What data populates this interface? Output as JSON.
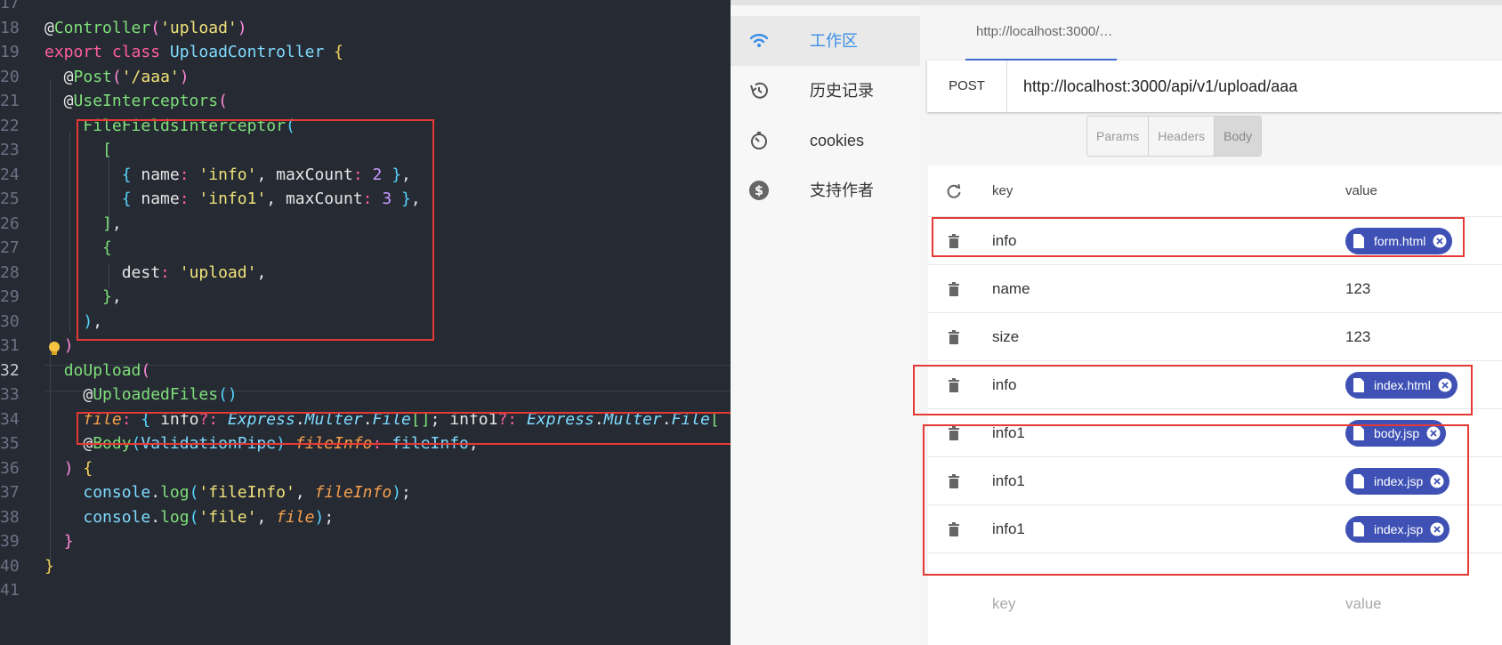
{
  "editor": {
    "lines": [
      {
        "num": "17",
        "active": false,
        "tokens": []
      },
      {
        "num": "18",
        "active": false,
        "tokens": [
          [
            "@",
            "t-at"
          ],
          [
            "Controller",
            "t-dec"
          ],
          [
            "(",
            "t-par"
          ],
          [
            "'upload'",
            "t-str"
          ],
          [
            ")",
            "t-par"
          ]
        ]
      },
      {
        "num": "19",
        "active": false,
        "tokens": [
          [
            "export ",
            "t-kw"
          ],
          [
            "class ",
            "t-kw"
          ],
          [
            "UploadController ",
            "t-cls"
          ],
          [
            "{",
            "t-yel"
          ]
        ]
      },
      {
        "num": "20",
        "active": false,
        "tokens": [
          [
            "  @",
            "t-at"
          ],
          [
            "Post",
            "t-dec"
          ],
          [
            "(",
            "t-par"
          ],
          [
            "'/aaa'",
            "t-str"
          ],
          [
            ")",
            "t-par"
          ]
        ]
      },
      {
        "num": "21",
        "active": false,
        "tokens": [
          [
            "  @",
            "t-at"
          ],
          [
            "UseInterceptors",
            "t-dec"
          ],
          [
            "(",
            "t-par"
          ]
        ]
      },
      {
        "num": "22",
        "active": false,
        "tokens": [
          [
            "    ",
            "t-at"
          ],
          [
            "FileFieldsInterceptor",
            "t-fn"
          ],
          [
            "(",
            "t-br"
          ]
        ]
      },
      {
        "num": "23",
        "active": false,
        "tokens": [
          [
            "      ",
            "t-at"
          ],
          [
            "[",
            "t-dec"
          ]
        ]
      },
      {
        "num": "24",
        "active": false,
        "tokens": [
          [
            "        ",
            "t-at"
          ],
          [
            "{",
            "t-br"
          ],
          [
            " name",
            "t-prop"
          ],
          [
            ": ",
            "t-op"
          ],
          [
            "'info'",
            "t-str"
          ],
          [
            ", maxCount",
            "t-prop"
          ],
          [
            ": ",
            "t-op"
          ],
          [
            "2",
            "t-num"
          ],
          [
            " }",
            "t-br"
          ],
          [
            ",",
            "t-prop"
          ]
        ]
      },
      {
        "num": "25",
        "active": false,
        "tokens": [
          [
            "        ",
            "t-at"
          ],
          [
            "{",
            "t-br"
          ],
          [
            " name",
            "t-prop"
          ],
          [
            ": ",
            "t-op"
          ],
          [
            "'info1'",
            "t-str"
          ],
          [
            ", maxCount",
            "t-prop"
          ],
          [
            ": ",
            "t-op"
          ],
          [
            "3",
            "t-num"
          ],
          [
            " }",
            "t-br"
          ],
          [
            ",",
            "t-prop"
          ]
        ]
      },
      {
        "num": "26",
        "active": false,
        "tokens": [
          [
            "      ",
            "t-at"
          ],
          [
            "]",
            "t-dec"
          ],
          [
            ",",
            "t-prop"
          ]
        ]
      },
      {
        "num": "27",
        "active": false,
        "tokens": [
          [
            "      ",
            "t-at"
          ],
          [
            "{",
            "t-dec"
          ]
        ]
      },
      {
        "num": "28",
        "active": false,
        "tokens": [
          [
            "        dest",
            "t-prop"
          ],
          [
            ": ",
            "t-op"
          ],
          [
            "'upload'",
            "t-str"
          ],
          [
            ",",
            "t-prop"
          ]
        ]
      },
      {
        "num": "29",
        "active": false,
        "tokens": [
          [
            "      ",
            "t-at"
          ],
          [
            "}",
            "t-dec"
          ],
          [
            ",",
            "t-prop"
          ]
        ]
      },
      {
        "num": "30",
        "active": false,
        "tokens": [
          [
            "    ",
            "t-at"
          ],
          [
            ")",
            "t-br"
          ],
          [
            ",",
            "t-prop"
          ]
        ]
      },
      {
        "num": "31",
        "active": false,
        "tokens": [
          [
            "  ",
            "t-at"
          ],
          [
            ")",
            "t-par"
          ]
        ]
      },
      {
        "num": "32",
        "active": true,
        "tokens": [
          [
            "  ",
            "t-at"
          ],
          [
            "doUpload",
            "t-fn"
          ],
          [
            "(",
            "t-par"
          ]
        ]
      },
      {
        "num": "33",
        "active": false,
        "tokens": [
          [
            "    @",
            "t-at"
          ],
          [
            "UploadedFiles",
            "t-dec"
          ],
          [
            "()",
            "t-br"
          ]
        ]
      },
      {
        "num": "34",
        "active": false,
        "tokens": [
          [
            "    ",
            "t-at"
          ],
          [
            "file",
            "t-it"
          ],
          [
            ": ",
            "t-op"
          ],
          [
            "{",
            "t-br"
          ],
          [
            " info",
            "t-prop"
          ],
          [
            "?: ",
            "t-op"
          ],
          [
            "Express",
            "t-itc"
          ],
          [
            ".",
            "t-prop"
          ],
          [
            "Multer",
            "t-itc"
          ],
          [
            ".",
            "t-prop"
          ],
          [
            "File",
            "t-itc"
          ],
          [
            "[]",
            "t-dec"
          ],
          [
            "; info1",
            "t-prop"
          ],
          [
            "?: ",
            "t-op"
          ],
          [
            "Express",
            "t-itc"
          ],
          [
            ".",
            "t-prop"
          ],
          [
            "Multer",
            "t-itc"
          ],
          [
            ".",
            "t-prop"
          ],
          [
            "File",
            "t-itc"
          ],
          [
            "[",
            "t-dec"
          ]
        ]
      },
      {
        "num": "35",
        "active": false,
        "tokens": [
          [
            "    @",
            "t-at"
          ],
          [
            "Body",
            "t-dec"
          ],
          [
            "(",
            "t-br"
          ],
          [
            "ValidationPipe",
            "t-cls"
          ],
          [
            ") ",
            "t-br"
          ],
          [
            "fileInfo",
            "t-it"
          ],
          [
            ": ",
            "t-op"
          ],
          [
            "fileInfo",
            "t-cls"
          ],
          [
            ",",
            "t-prop"
          ]
        ]
      },
      {
        "num": "36",
        "active": false,
        "tokens": [
          [
            "  ",
            "t-at"
          ],
          [
            ")",
            "t-par"
          ],
          [
            " {",
            "t-yel"
          ]
        ]
      },
      {
        "num": "37",
        "active": false,
        "tokens": [
          [
            "    ",
            "t-at"
          ],
          [
            "console",
            "t-cls"
          ],
          [
            ".",
            "t-prop"
          ],
          [
            "log",
            "t-fn"
          ],
          [
            "(",
            "t-br"
          ],
          [
            "'fileInfo'",
            "t-str"
          ],
          [
            ", ",
            "t-prop"
          ],
          [
            "fileInfo",
            "t-it"
          ],
          [
            ")",
            "t-br"
          ],
          [
            ";",
            "t-prop"
          ]
        ]
      },
      {
        "num": "38",
        "active": false,
        "tokens": [
          [
            "    ",
            "t-at"
          ],
          [
            "console",
            "t-cls"
          ],
          [
            ".",
            "t-prop"
          ],
          [
            "log",
            "t-fn"
          ],
          [
            "(",
            "t-br"
          ],
          [
            "'file'",
            "t-str"
          ],
          [
            ", ",
            "t-prop"
          ],
          [
            "file",
            "t-it"
          ],
          [
            ")",
            "t-br"
          ],
          [
            ";",
            "t-prop"
          ]
        ]
      },
      {
        "num": "39",
        "active": false,
        "tokens": [
          [
            "  ",
            "t-at"
          ],
          [
            "}",
            "t-par"
          ]
        ]
      },
      {
        "num": "40",
        "active": false,
        "tokens": [
          [
            "}",
            "t-yel"
          ]
        ]
      },
      {
        "num": "41",
        "active": false,
        "tokens": []
      }
    ]
  },
  "sidebar": {
    "items": [
      {
        "label": "工作区",
        "icon": "wifi-icon"
      },
      {
        "label": "历史记录",
        "icon": "history-icon"
      },
      {
        "label": "cookies",
        "icon": "timer-icon"
      },
      {
        "label": "支持作者",
        "icon": "dollar-icon"
      }
    ]
  },
  "tab": {
    "label": "http://localhost:3000/…"
  },
  "request": {
    "method": "POST",
    "url": "http://localhost:3000/api/v1/upload/aaa"
  },
  "segments": {
    "params": "Params",
    "headers": "Headers",
    "body": "Body"
  },
  "table": {
    "header": {
      "key": "key",
      "value": "value",
      "icon": "refresh-icon"
    },
    "rows": [
      {
        "key": "info",
        "value": "form.html",
        "file": true
      },
      {
        "key": "name",
        "value": "123",
        "file": false
      },
      {
        "key": "size",
        "value": "123",
        "file": false
      },
      {
        "key": "info",
        "value": "index.html",
        "file": true
      },
      {
        "key": "info1",
        "value": "body.jsp",
        "file": true
      },
      {
        "key": "info1",
        "value": "index.jsp",
        "file": true
      },
      {
        "key": "info1",
        "value": "index.jsp",
        "file": true
      }
    ],
    "placeholder": {
      "key": "key",
      "value": "value"
    }
  },
  "colors": {
    "chip": "#3f51b5",
    "highlight": "#e53935",
    "accent": "#3a8ee6"
  }
}
